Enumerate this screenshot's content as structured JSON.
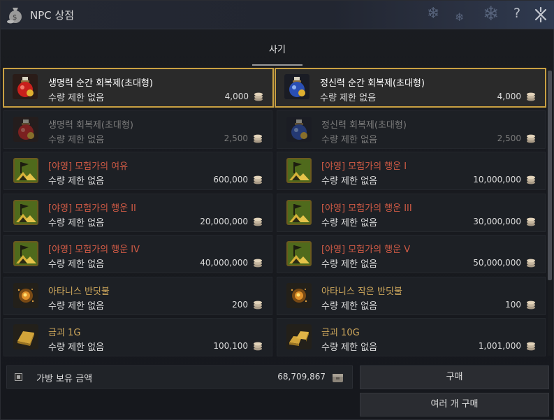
{
  "window": {
    "title": "NPC 상점"
  },
  "tabs": [
    {
      "label": "사기",
      "active": true
    }
  ],
  "items": [
    {
      "name": "생명력 순간 회복제(초대형)",
      "limit": "수량 제한 없음",
      "price": "4,000",
      "icon": "red-potion-icon",
      "name_style": "white",
      "state": "selected"
    },
    {
      "name": "정신력 순간 회복제(초대형)",
      "limit": "수량 제한 없음",
      "price": "4,000",
      "icon": "blue-potion-icon",
      "name_style": "white",
      "state": "selected"
    },
    {
      "name": "생명력 회복제(초대형)",
      "limit": "수량 제한 없음",
      "price": "2,500",
      "icon": "red-potion-icon",
      "name_style": "white",
      "state": "dimmed"
    },
    {
      "name": "정신력 회복제(초대형)",
      "limit": "수량 제한 없음",
      "price": "2,500",
      "icon": "blue-potion-icon",
      "name_style": "white",
      "state": "dimmed"
    },
    {
      "name": "[야영] 모험가의 여유",
      "limit": "수량 제한 없음",
      "price": "600,000",
      "icon": "camp-flag-icon",
      "name_style": "red",
      "state": "normal"
    },
    {
      "name": "[야영] 모험가의 행운 I",
      "limit": "수량 제한 없음",
      "price": "10,000,000",
      "icon": "camp-flag-icon",
      "name_style": "red",
      "state": "normal"
    },
    {
      "name": "[야영] 모험가의 행운 II",
      "limit": "수량 제한 없음",
      "price": "20,000,000",
      "icon": "camp-flag-icon",
      "name_style": "red",
      "state": "normal"
    },
    {
      "name": "[야영] 모험가의 행운 III",
      "limit": "수량 제한 없음",
      "price": "30,000,000",
      "icon": "camp-flag-icon",
      "name_style": "red",
      "state": "normal"
    },
    {
      "name": "[야영] 모험가의 행운 IV",
      "limit": "수량 제한 없음",
      "price": "40,000,000",
      "icon": "camp-flag-icon",
      "name_style": "red",
      "state": "normal"
    },
    {
      "name": "[야영] 모험가의 행운 V",
      "limit": "수량 제한 없음",
      "price": "50,000,000",
      "icon": "camp-flag-icon",
      "name_style": "red",
      "state": "normal"
    },
    {
      "name": "아타니스 반딧불",
      "limit": "수량 제한 없음",
      "price": "200",
      "icon": "firefly-icon",
      "name_style": "gold",
      "state": "normal"
    },
    {
      "name": "아타니스 작은 반딧불",
      "limit": "수량 제한 없음",
      "price": "100",
      "icon": "firefly-icon",
      "name_style": "gold",
      "state": "normal"
    },
    {
      "name": "금괴 1G",
      "limit": "수량 제한 없음",
      "price": "100,100",
      "icon": "gold-bar-icon",
      "name_style": "gold",
      "state": "normal"
    },
    {
      "name": "금괴 10G",
      "limit": "수량 제한 없음",
      "price": "1,001,000",
      "icon": "gold-bars-icon",
      "name_style": "gold",
      "state": "normal"
    }
  ],
  "wallet": {
    "label": "가방 보유 금액",
    "amount": "68,709,867"
  },
  "buttons": {
    "buy": "구매",
    "buy_multiple": "여러 개 구매"
  },
  "colors": {
    "accent_gold": "#c9a042",
    "name_red": "#d05a45",
    "name_gold": "#cfa85c"
  }
}
